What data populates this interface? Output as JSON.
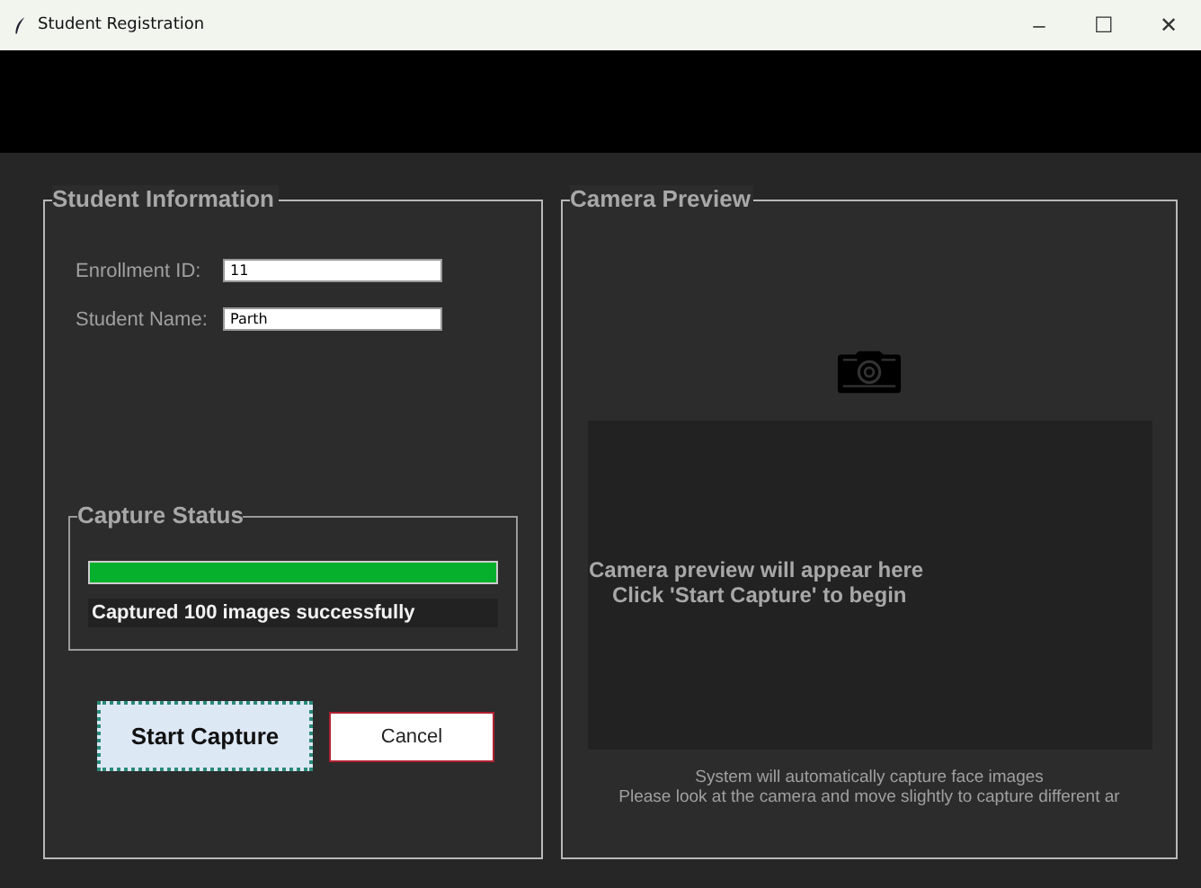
{
  "window": {
    "title": "Student Registration",
    "controls": [
      "–",
      "☐",
      "✕"
    ]
  },
  "student_information": {
    "title": "Student Information",
    "fields": [
      {
        "label": "Enrollment ID:",
        "value": "11"
      },
      {
        "label": "Student Name:",
        "value": "Parth"
      }
    ]
  },
  "capture_status": {
    "title": "Capture Status",
    "level": 1.0,
    "message": "Captured 100 images successfully"
  },
  "buttons": [
    {
      "label": "Start Capture",
      "kind": "primary"
    },
    {
      "label": "Cancel",
      "kind": "secondary"
    }
  ],
  "camera_preview": {
    "title": "Camera Preview",
    "placeholder_lines": [
      "Camera preview will appear here",
      "Click 'Start Capture' to begin"
    ],
    "hints": [
      "System will automatically capture face images",
      "Please look at the camera and move slightly to capture different ar"
    ]
  }
}
